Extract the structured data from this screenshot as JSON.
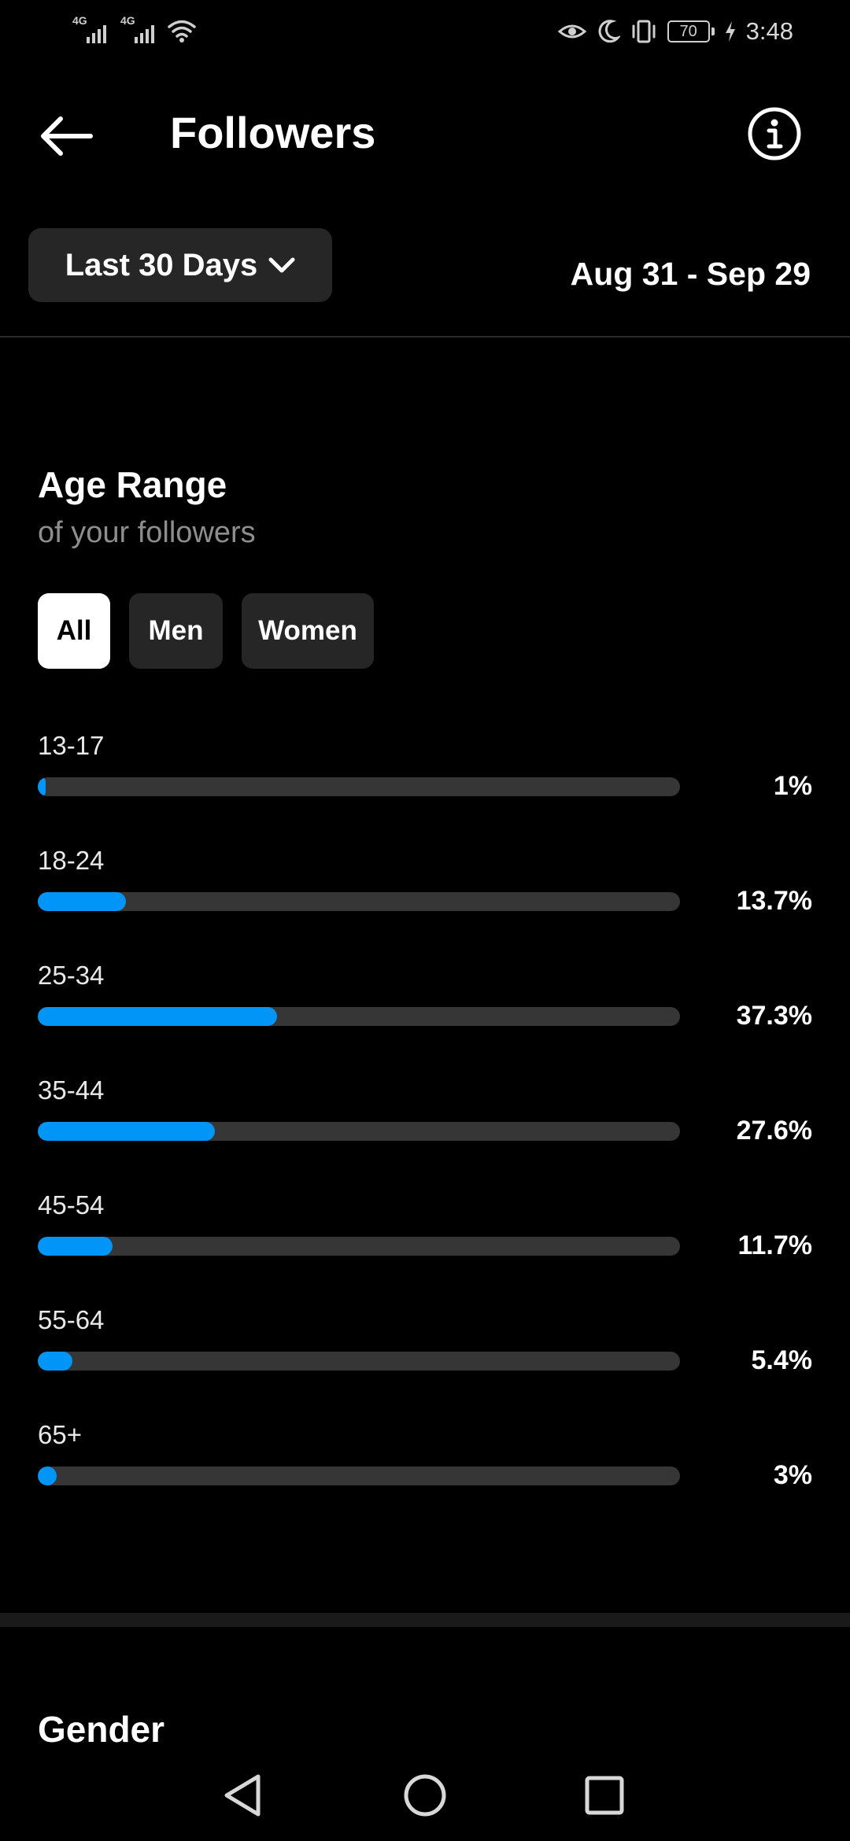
{
  "status_bar": {
    "network_1": "4G",
    "network_2": "4G",
    "battery_level": "70",
    "time": "3:48",
    "icons": [
      "signal-icon",
      "signal-icon",
      "wifi-icon",
      "eye-comfort-icon",
      "moon-icon",
      "vibrate-icon",
      "battery-icon",
      "charging-icon"
    ]
  },
  "header": {
    "title": "Followers",
    "back_icon": "arrow-left-icon",
    "info_icon": "info-icon"
  },
  "filter": {
    "range_label": "Last 30 Days",
    "date_range": "Aug 31 - Sep 29"
  },
  "age_section": {
    "title": "Age Range",
    "subtitle": "of your followers",
    "tabs": [
      {
        "label": "All",
        "active": true
      },
      {
        "label": "Men",
        "active": false
      },
      {
        "label": "Women",
        "active": false
      }
    ],
    "rows": [
      {
        "label": "13-17",
        "percent_text": "1%",
        "value": 1
      },
      {
        "label": "18-24",
        "percent_text": "13.7%",
        "value": 13.7
      },
      {
        "label": "25-34",
        "percent_text": "37.3%",
        "value": 37.3
      },
      {
        "label": "35-44",
        "percent_text": "27.6%",
        "value": 27.6
      },
      {
        "label": "45-54",
        "percent_text": "11.7%",
        "value": 11.7
      },
      {
        "label": "55-64",
        "percent_text": "5.4%",
        "value": 5.4
      },
      {
        "label": "65+",
        "percent_text": "3%",
        "value": 3
      }
    ]
  },
  "gender_section": {
    "title": "Gender"
  },
  "colors": {
    "background": "#000000",
    "bar_fill": "#0095f6",
    "bar_track": "#363636",
    "chip_bg": "#262626",
    "chip_active_bg": "#ffffff"
  }
}
